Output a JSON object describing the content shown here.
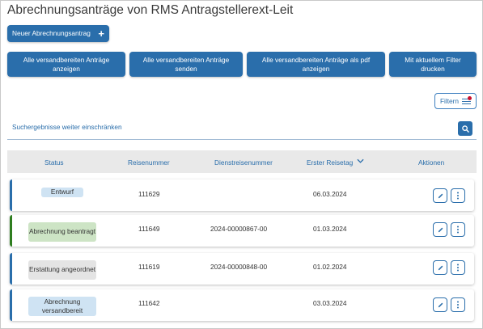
{
  "page": {
    "title": "Abrechnungsanträge von RMS Antragstellerext-Leit"
  },
  "toolbar": {
    "new_label": "Neuer Abrechnungsantrag",
    "actions": [
      "Alle versandbereiten Anträge anzeigen",
      "Alle versandbereiten Anträge senden",
      "Alle versandbereiten Anträge als pdf anzeigen",
      "Mit aktuellem Filter drucken"
    ],
    "filter_label": "Filtern"
  },
  "search": {
    "refine_label": "Suchergebnisse weiter einschränken"
  },
  "table": {
    "headers": [
      "Status",
      "Reisenummer",
      "Dienstreisenummer",
      "Erster Reisetag",
      "Aktionen"
    ],
    "rows": [
      {
        "status": "Entwurf",
        "reisenummer": "111629",
        "dienstreisenummer": "",
        "erster_reisetag": "06.03.2024",
        "status_color": "#cfe3f3",
        "accent": "#2a6eab"
      },
      {
        "status": "Abrechnung beantragt",
        "reisenummer": "111649",
        "dienstreisenummer": "2024-00000867-00",
        "erster_reisetag": "01.03.2024",
        "status_color": "#cde4c5",
        "accent": "#2e7d1f"
      },
      {
        "status": "Erstattung angeordnet",
        "reisenummer": "111619",
        "dienstreisenummer": "2024-00000848-00",
        "erster_reisetag": "01.02.2024",
        "status_color": "#e4e4e4",
        "accent": "#2a6eab"
      },
      {
        "status": "Abrechnung versandbereit",
        "reisenummer": "111642",
        "dienstreisenummer": "",
        "erster_reisetag": "03.03.2024",
        "status_color": "#cfe3f3",
        "accent": "#2a6eab"
      }
    ]
  },
  "icons": {
    "new": "plus-icon",
    "filter": "filter-sliders-icon",
    "search": "search-icon",
    "sort": "chevron-down-icon",
    "edit": "pencil-icon",
    "more": "more-vertical-icon"
  },
  "colors": {
    "primary": "#2a6eab",
    "header_bg": "#e9e9e9",
    "filter_dot": "#c8102e"
  }
}
